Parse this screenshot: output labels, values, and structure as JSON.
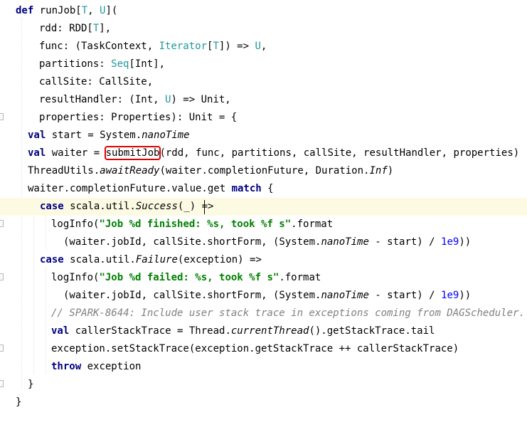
{
  "editor": {
    "language": "scala",
    "highlighted_token": "submitJob",
    "lines": [
      "def runJob[T, U](",
      "rdd: RDD[T],",
      "func: (TaskContext, Iterator[T]) => U,",
      "partitions: Seq[Int],",
      "callSite: CallSite,",
      "resultHandler: (Int, U) => Unit,",
      "properties: Properties): Unit = {",
      "val start = System.nanoTime",
      "val waiter = submitJob(rdd, func, partitions, callSite, resultHandler, properties)",
      "ThreadUtils.awaitReady(waiter.completionFuture, Duration.Inf)",
      "waiter.completionFuture.value.get match {",
      "case scala.util.Success(_) =>",
      "logInfo(\"Job %d finished: %s, took %f s\".format",
      "(waiter.jobId, callSite.shortForm, (System.nanoTime - start) / 1e9))",
      "case scala.util.Failure(exception) =>",
      "logInfo(\"Job %d failed: %s, took %f s\".format",
      "(waiter.jobId, callSite.shortForm, (System.nanoTime - start) / 1e9))",
      "// SPARK-8644: Include user stack trace in exceptions coming from DAGScheduler.",
      "val callerStackTrace = Thread.currentThread().getStackTrace.tail",
      "exception.setStackTrace(exception.getStackTrace ++ callerStackTrace)",
      "throw exception",
      "}",
      "}"
    ]
  },
  "colors": {
    "keyword": "#000080",
    "type_param": "#20999d",
    "string": "#008000",
    "number": "#0000ff",
    "comment": "#808080",
    "highlight_box": "#e00000",
    "current_line": "#fdfae4"
  }
}
